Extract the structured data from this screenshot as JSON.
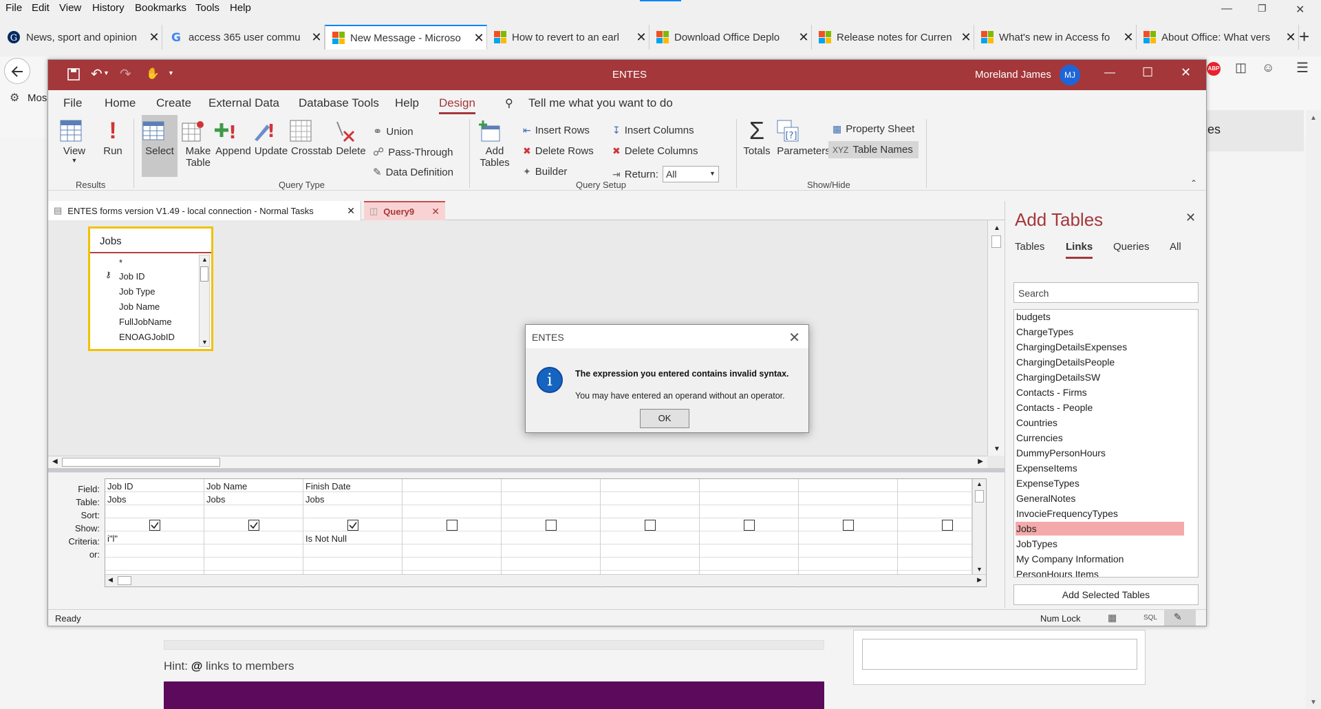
{
  "browser": {
    "menu": [
      "File",
      "Edit",
      "View",
      "History",
      "Bookmarks",
      "Tools",
      "Help"
    ],
    "tabs": [
      {
        "title": "News, sport and opinion",
        "icon": "guardian-icon"
      },
      {
        "title": "access 365 user commu",
        "icon": "google-icon"
      },
      {
        "title": "New Message - Microso",
        "icon": "microsoft-icon",
        "active": true
      },
      {
        "title": "How to revert to an earl",
        "icon": "microsoft-icon"
      },
      {
        "title": "Download Office Deplo",
        "icon": "microsoft-icon"
      },
      {
        "title": "Release notes for Curren",
        "icon": "microsoft-icon"
      },
      {
        "title": "What's new in Access fo",
        "icon": "microsoft-icon"
      },
      {
        "title": "About Office: What vers",
        "icon": "microsoft-icon"
      }
    ],
    "bookmark_partial": "Mos",
    "page_partial_text": "es",
    "hint_label": "Hint:",
    "hint_at": "@",
    "hint_text": "links to members"
  },
  "access": {
    "window_title": "ENTES",
    "user_name": "Moreland James",
    "user_initials": "MJ",
    "ribbon_tabs": [
      "File",
      "Home",
      "Create",
      "External Data",
      "Database Tools",
      "Help",
      "Design"
    ],
    "selected_tab": "Design",
    "tell_me": "Tell me what you want to do",
    "results": {
      "view": "View",
      "run": "Run",
      "group": "Results"
    },
    "query_type": {
      "select": "Select",
      "make": "Make",
      "table": "Table",
      "append": "Append",
      "update": "Update",
      "crosstab": "Crosstab",
      "delete": "Delete",
      "union": "Union",
      "pass_through": "Pass-Through",
      "data_definition": "Data Definition",
      "group": "Query Type"
    },
    "query_setup": {
      "add": "Add",
      "tables": "Tables",
      "insert_rows": "Insert Rows",
      "delete_rows": "Delete Rows",
      "builder": "Builder",
      "insert_columns": "Insert Columns",
      "delete_columns": "Delete Columns",
      "return_label": "Return:",
      "return_value": "All",
      "group": "Query Setup"
    },
    "show_hide": {
      "totals": "Totals",
      "parameters": "Parameters",
      "property_sheet": "Property Sheet",
      "table_names": "Table Names",
      "group": "Show/Hide"
    },
    "doc_tabs": [
      {
        "title": "ENTES forms version V1.49 - local connection  - Normal Tasks"
      },
      {
        "title": "Query9",
        "active": true
      }
    ],
    "jobs_table": {
      "title": "Jobs",
      "fields": [
        "*",
        "Job ID",
        "Job Type",
        "Job Name",
        "FullJobName",
        "ENOAGJobID"
      ]
    },
    "qbe": {
      "row_labels": [
        "Field:",
        "Table:",
        "Sort:",
        "Show:",
        "Criteria:",
        "or:"
      ],
      "columns": [
        {
          "field": "Job ID",
          "table": "Jobs",
          "show": true,
          "criteria": "i\"l\""
        },
        {
          "field": "Job Name",
          "table": "Jobs",
          "show": true,
          "criteria": ""
        },
        {
          "field": "Finish Date",
          "table": "Jobs",
          "show": true,
          "criteria": "Is Not Null"
        },
        {
          "field": "",
          "table": "",
          "show": false,
          "criteria": ""
        },
        {
          "field": "",
          "table": "",
          "show": false,
          "criteria": ""
        },
        {
          "field": "",
          "table": "",
          "show": false,
          "criteria": ""
        },
        {
          "field": "",
          "table": "",
          "show": false,
          "criteria": ""
        },
        {
          "field": "",
          "table": "",
          "show": false,
          "criteria": ""
        },
        {
          "field": "",
          "table": "",
          "show": false,
          "criteria": ""
        }
      ]
    },
    "status": {
      "left": "Ready",
      "num_lock": "Num Lock",
      "sql": "SQL"
    },
    "add_tables": {
      "title": "Add Tables",
      "tabs": [
        "Tables",
        "Links",
        "Queries",
        "All"
      ],
      "selected_tab": "Links",
      "search_placeholder": "Search",
      "items": [
        "budgets",
        "ChargeTypes",
        "ChargingDetailsExpenses",
        "ChargingDetailsPeople",
        "ChargingDetailsSW",
        "Contacts - Firms",
        "Contacts - People",
        "Countries",
        "Currencies",
        "DummyPersonHours",
        "ExpenseItems",
        "ExpenseTypes",
        "GeneralNotes",
        "InvocieFrequencyTypes",
        "Jobs",
        "JobTypes",
        "My Company Information",
        "PersonHours Items"
      ],
      "highlighted": "Jobs",
      "add_button": "Add Selected Tables"
    },
    "dialog": {
      "title": "ENTES",
      "message_bold": "The expression you entered contains invalid syntax.",
      "message": "You may have entered an operand without an operator.",
      "ok": "OK",
      "icon_glyph": "i"
    }
  },
  "colors": {
    "access_red": "#a4373a",
    "highlight": "#f4aaaa",
    "accent_blue": "#1e66d8"
  }
}
